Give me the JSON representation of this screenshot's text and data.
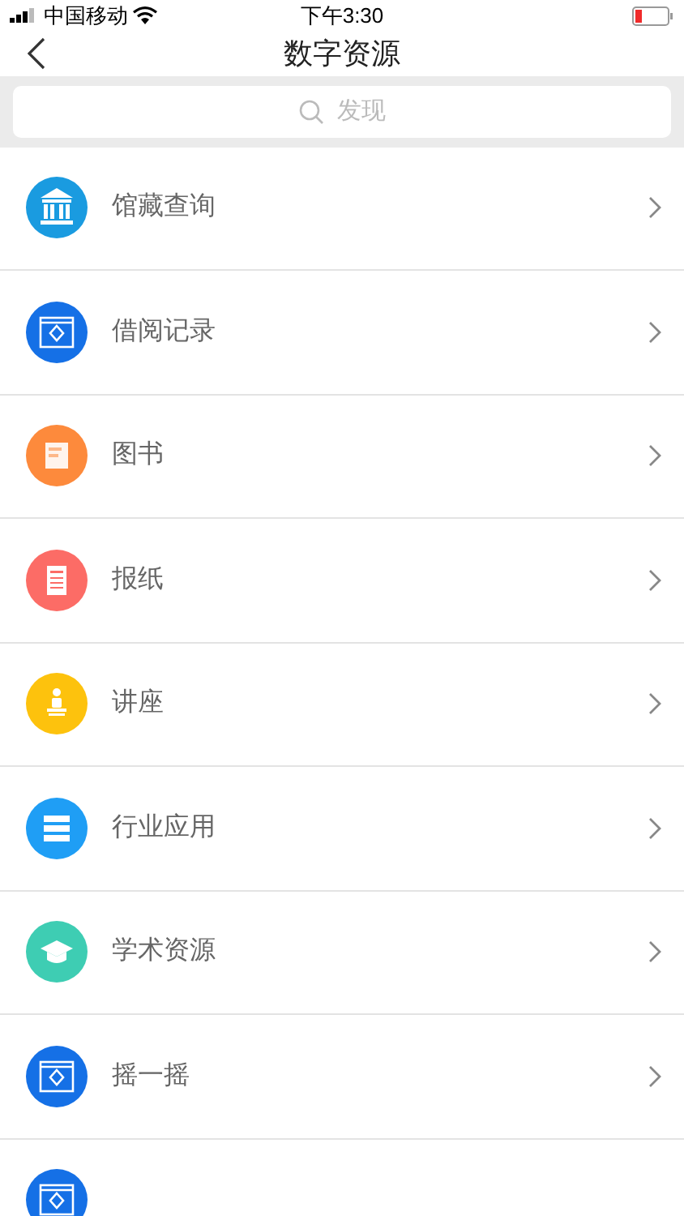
{
  "status_bar": {
    "carrier": "中国移动",
    "time": "下午3:30"
  },
  "nav": {
    "title": "数字资源"
  },
  "search": {
    "placeholder": "发现"
  },
  "items": [
    {
      "label": "馆藏查询",
      "kind": "museum",
      "color": "#1a9be0"
    },
    {
      "label": "借阅记录",
      "kind": "window",
      "color": "#1570e6"
    },
    {
      "label": "图书",
      "kind": "book",
      "color": "#fd8a3c"
    },
    {
      "label": "报纸",
      "kind": "news",
      "color": "#fc6c66"
    },
    {
      "label": "讲座",
      "kind": "lecture",
      "color": "#fdc20d"
    },
    {
      "label": "行业应用",
      "kind": "server",
      "color": "#1f9ef5"
    },
    {
      "label": "学术资源",
      "kind": "cap",
      "color": "#3ecdb3"
    },
    {
      "label": "摇一摇",
      "kind": "window",
      "color": "#1570e6"
    },
    {
      "kind": "window",
      "color": "#1570e6"
    }
  ]
}
